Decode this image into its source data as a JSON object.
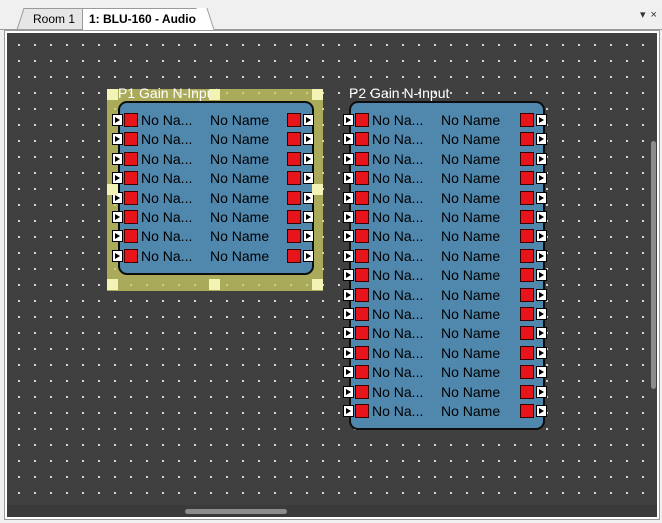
{
  "tabs": [
    {
      "label": "Room 1",
      "active": false
    },
    {
      "label": "1: BLU-160 - Audio",
      "active": true
    }
  ],
  "tab_menu_label": "▾ ×",
  "blocks": [
    {
      "id": "P1",
      "title": "P1  Gain N-Input",
      "selected": true,
      "channels": 8,
      "input_label": "No Na...",
      "output_label": "No Name"
    },
    {
      "id": "P2",
      "title": "P2  Gain N-Input",
      "selected": false,
      "channels": 16,
      "input_label": "No Na...",
      "output_label": "No Name"
    }
  ],
  "colors": {
    "canvas": "#404040",
    "block_fill": "#4f87ad",
    "pin_square": "#e8141c",
    "selection": "#d0d070"
  }
}
